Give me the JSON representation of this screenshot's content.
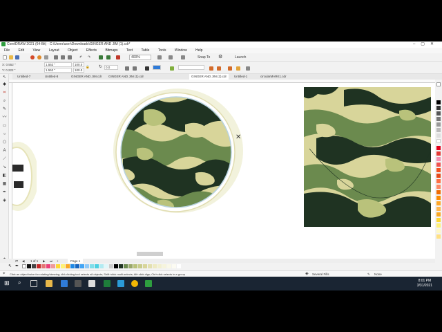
{
  "window": {
    "title": "CorelDRAW 2021 (64-Bit) - C:\\Users\\user\\Downloads\\GINGER AND JIM (1).cdr*"
  },
  "menu": [
    "File",
    "Edit",
    "View",
    "Layout",
    "Object",
    "Effects",
    "Bitmaps",
    "Text",
    "Table",
    "Tools",
    "Window",
    "Help"
  ],
  "toolbar": {
    "zoom": "400%",
    "snap_to": "Snap To",
    "launch": "Launch"
  },
  "propbar": {
    "x": "X: 0.552 \"",
    "y": "Y: 0.222 \"",
    "w": "1.552 \"",
    "h": "1.552 \"",
    "sx": "100.0",
    "sy": "100.0",
    "angle": "0.0"
  },
  "tabs": [
    "Untitled-7",
    "Untitled-8",
    "GINGER AND JIM.cdr",
    "GINGER AND JIM (1).cdr",
    "GINGER AND JIM (2).cdr",
    "Untitled-1",
    "circularMARK1.cdr"
  ],
  "pager": {
    "page_count": "1 of 1",
    "page_tab": "Page 1"
  },
  "status": {
    "hint": "Click an object twice for rotating/skewing; dbl-clicking tool selects all objects; Shift+click multi-selects; Alt+click digs; Ctrl+click selects in a group",
    "fill": "Several Fills",
    "outline": "None"
  },
  "clock": {
    "time": "8:01 PM",
    "date": "3/31/2021"
  },
  "colors": {
    "camo_dark": "#1f3322",
    "camo_mid": "#6b8a4e",
    "camo_light": "#d8d59a",
    "camo_sand": "#b9c27b",
    "taskbar": "#1a2533",
    "accent": "#2e9e3f"
  },
  "icons": [
    "corel-app-icon",
    "new-icon",
    "open-icon",
    "save-icon",
    "undo-icon",
    "redo-icon",
    "import-icon",
    "export-icon",
    "search-icon",
    "windows-start-icon"
  ]
}
